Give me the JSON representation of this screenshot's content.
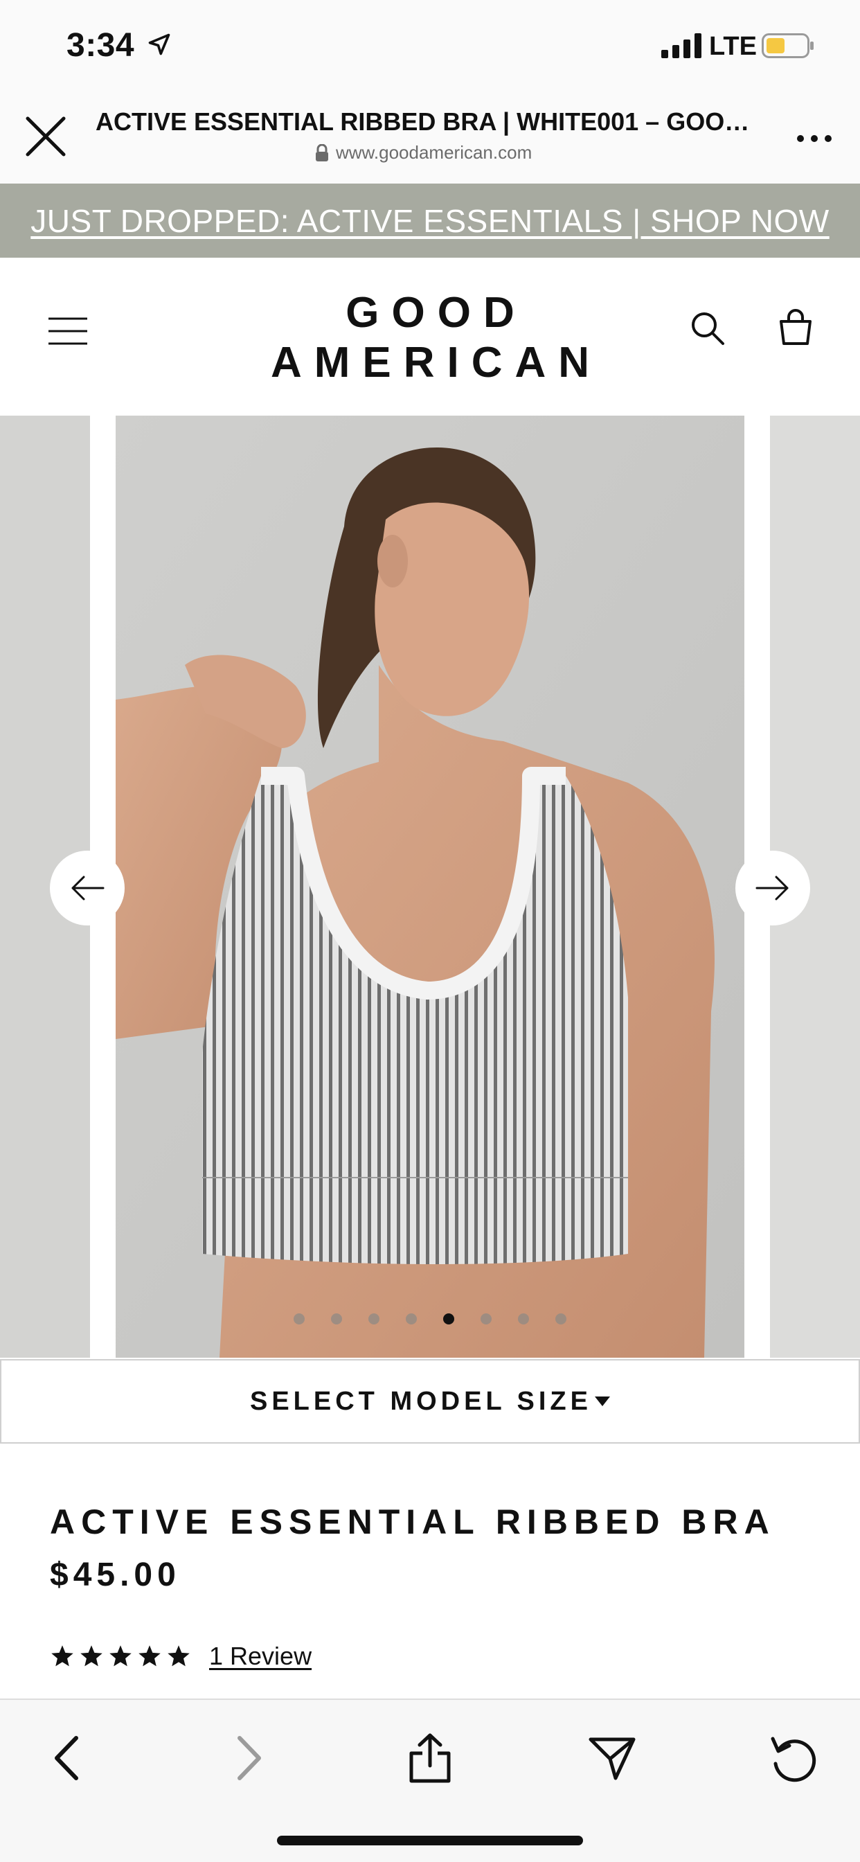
{
  "status_bar": {
    "time": "3:34",
    "network": "LTE",
    "battery_color": "#f5c842"
  },
  "browser": {
    "page_title": "ACTIVE ESSENTIAL RIBBED BRA | WHITE001 – GOOD...",
    "url": "www.goodamerican.com"
  },
  "promo": {
    "text": "JUST DROPPED: ACTIVE ESSENTIALS | SHOP NOW",
    "background": "#a7aaa0"
  },
  "header": {
    "logo_line1": "GOOD",
    "logo_line2": "AMERICAN"
  },
  "carousel": {
    "slide_count": 8,
    "active_index": 4
  },
  "model_size": {
    "label": "SELECT MODEL SIZE"
  },
  "product": {
    "name": "ACTIVE ESSENTIAL RIBBED BRA",
    "price": "$45.00",
    "rating": 5,
    "review_link": "1 Review"
  },
  "toolbar": {
    "items": [
      "back-icon",
      "forward-icon",
      "share-icon",
      "send-icon",
      "reload-icon"
    ]
  }
}
